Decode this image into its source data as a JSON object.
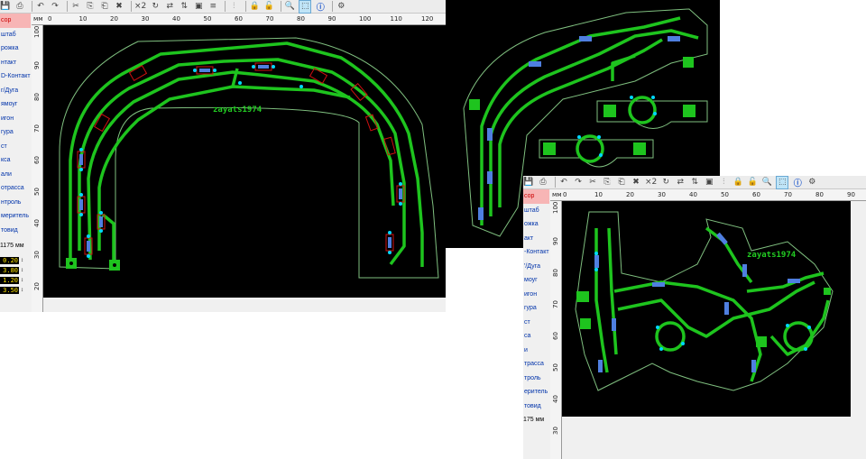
{
  "toolbar_icons": [
    "save-icon",
    "print-icon",
    "undo-icon",
    "redo-icon",
    "cut-icon",
    "copy-icon",
    "paste-icon",
    "delete-icon",
    "rotate-icon",
    "mirror-h-icon",
    "mirror-v-icon",
    "group-icon",
    "align-icon",
    "hierarchy-icon",
    "lock-icon",
    "unlock-icon",
    "zoom-icon",
    "select-icon",
    "info-icon",
    "settings-icon"
  ],
  "toolbar": {
    "x2": "×2"
  },
  "units": "мм",
  "window1": {
    "sidebar": [
      "сор",
      "штаб",
      "рожка",
      "нтакт",
      "D-Контакт",
      "г/Дуга",
      "ямоуг",
      "игон",
      "гура",
      "ст",
      "кса",
      "али",
      "отрасса",
      "нтроль",
      "меритель",
      "товид"
    ],
    "grid_label": "1175 мм",
    "fields": [
      "0.20",
      "3.80",
      "1.20",
      "3.50"
    ],
    "ruler_x": [
      "0",
      "10",
      "20",
      "30",
      "40",
      "50",
      "60",
      "70",
      "80",
      "90",
      "100",
      "110",
      "120"
    ],
    "ruler_y": [
      "100",
      "90",
      "80",
      "70",
      "60",
      "50",
      "40",
      "30",
      "20"
    ],
    "watermark": "zayats1974"
  },
  "window3": {
    "sidebar": [
      "сор",
      "штаб",
      "ожка",
      "акт",
      "-Контакт",
      "'/Дуга",
      "моуг",
      "игон",
      "гура",
      "ст",
      "са",
      "и",
      "трасса",
      "троль",
      "еритель",
      "товид"
    ],
    "grid_label": "175 мм",
    "ruler_x": [
      "0",
      "10",
      "20",
      "30",
      "40",
      "50",
      "60",
      "70",
      "80",
      "90"
    ],
    "ruler_y": [
      "100",
      "90",
      "80",
      "70",
      "60",
      "50",
      "40",
      "30"
    ],
    "watermark": "zayats1974"
  },
  "colors": {
    "board": "#000000",
    "track": "#1ec41e",
    "outline": "#7fbf7f",
    "pad": "#1ec41e",
    "component": "#d01010",
    "component_body": "#7aa0ff",
    "via": "#00c8ff"
  }
}
